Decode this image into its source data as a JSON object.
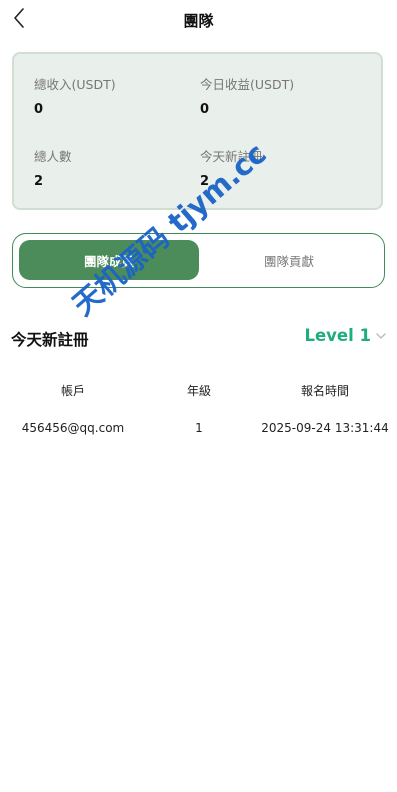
{
  "header": {
    "title": "團隊",
    "back_icon": "chevron-left-icon"
  },
  "stats": {
    "total_income_label": "總收入(USDT)",
    "total_income_value": "0",
    "today_income_label": "今日收益(USDT)",
    "today_income_value": "0",
    "total_members_label": "總人數",
    "total_members_value": "2",
    "today_new_label": "今天新註冊",
    "today_new_value": "2"
  },
  "tabs": {
    "members": "團隊成員",
    "contribution": "團隊貢獻"
  },
  "section": {
    "title": "今天新註冊",
    "level": "Level 1"
  },
  "table": {
    "headers": [
      "帳戶",
      "年級",
      "報名時間"
    ],
    "rows": [
      [
        "456456@qq.com",
        "1",
        "2025-09-24 13:31:44"
      ]
    ]
  },
  "watermark": "天机源码 tjym.cc",
  "colors": {
    "accent_green": "#4c8b5a",
    "level_green": "#1fae7b",
    "card_bg": "#e9efea",
    "watermark_blue": "#1a63c8"
  }
}
